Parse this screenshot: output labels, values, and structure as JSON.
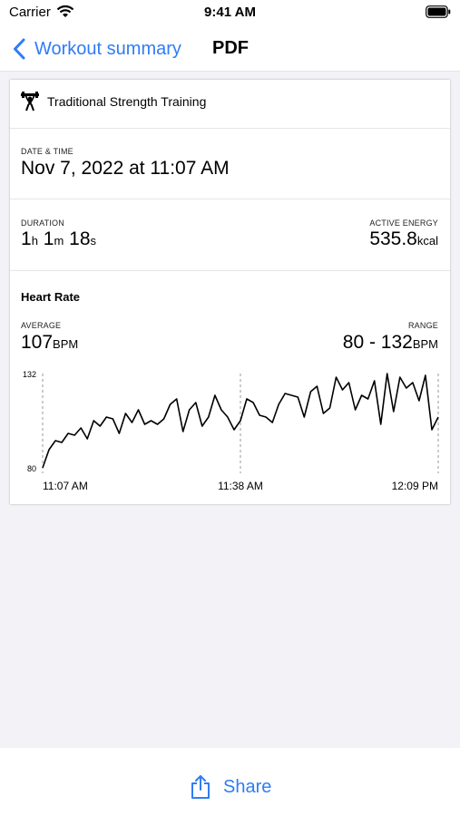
{
  "status_bar": {
    "carrier": "Carrier",
    "time": "9:41 AM"
  },
  "nav": {
    "back_label": "Workout summary",
    "title": "PDF"
  },
  "summary": {
    "workout_type": "Traditional Strength Training",
    "date_time_caption": "DATE & TIME",
    "date_time": "Nov 7, 2022 at 11:07 AM",
    "duration_caption": "DURATION",
    "duration": {
      "h": "1",
      "h_unit": "h",
      "m": "1",
      "m_unit": "m",
      "s": "18",
      "s_unit": "s"
    },
    "active_energy_caption": "ACTIVE ENERGY",
    "active_energy": {
      "value": "535.8",
      "unit": "kcal"
    }
  },
  "heart_rate": {
    "title": "Heart Rate",
    "average_caption": "AVERAGE",
    "average": {
      "value": "107",
      "unit": "BPM"
    },
    "range_caption": "RANGE",
    "range": {
      "value": "80 - 132",
      "unit": "BPM"
    }
  },
  "chart_data": {
    "type": "line",
    "ylim": [
      80,
      132
    ],
    "yticks": [
      "132",
      "80"
    ],
    "xticks": [
      "11:07 AM",
      "11:38 AM",
      "12:09 PM"
    ],
    "grid": "dashed vertical lines at x ticks",
    "x_minutes": [
      0,
      1,
      2,
      3,
      4,
      5,
      6,
      7,
      8,
      9,
      10,
      11,
      12,
      13,
      14,
      15,
      16,
      17,
      18,
      19,
      20,
      21,
      22,
      23,
      24,
      25,
      26,
      27,
      28,
      29,
      30,
      31,
      32,
      33,
      34,
      35,
      36,
      37,
      38,
      39,
      40,
      41,
      42,
      43,
      44,
      45,
      46,
      47,
      48,
      49,
      50,
      51,
      52,
      53,
      54,
      55,
      56,
      57,
      58,
      59,
      60,
      61,
      62
    ],
    "series": [
      {
        "values": [
          80,
          90,
          95,
          94,
          99,
          98,
          102,
          96,
          106,
          103,
          108,
          107,
          99,
          110,
          105,
          112,
          104,
          106,
          104,
          107,
          115,
          118,
          100,
          112,
          116,
          103,
          108,
          120,
          112,
          108,
          101,
          106,
          118,
          116,
          109,
          108,
          105,
          115,
          121,
          120,
          119,
          108,
          122,
          125,
          110,
          113,
          130,
          123,
          127,
          112,
          120,
          118,
          128,
          104,
          132,
          111,
          130,
          124,
          127,
          117,
          131,
          101,
          108
        ]
      }
    ]
  },
  "toolbar": {
    "share_label": "Share"
  },
  "colors": {
    "accent": "#2F7CF6",
    "background": "#F2F2F7",
    "line": "#000000"
  },
  "icons": {
    "back": "chevron-left-icon",
    "workout": "weightlifting-icon",
    "share": "share-icon",
    "wifi": "wifi-icon",
    "battery": "battery-icon"
  }
}
